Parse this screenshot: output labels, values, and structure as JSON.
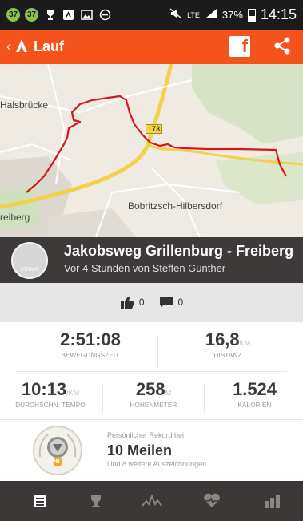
{
  "status_bar": {
    "notif_1": "37",
    "notif_2": "37",
    "network": "LTE",
    "battery": "37%",
    "time": "14:15"
  },
  "app_bar": {
    "title": "Lauf",
    "facebook_label": "f"
  },
  "map": {
    "labels": [
      "Halsbrücke",
      "Bobritzsch-Hilbersdorf",
      "reiberg"
    ],
    "road_number": "173",
    "route_color": "#d0181d"
  },
  "activity": {
    "title": "Jakobsweg Grillenburg - Freiberg",
    "subtitle": "Vor 4 Stunden von Steffen Günther",
    "avatar_text": "STRAVA"
  },
  "social": {
    "kudos_count": "0",
    "comments_count": "0"
  },
  "stats": {
    "moving_time": {
      "value": "2:51:08",
      "label": "BEWEGUNGSZEIT"
    },
    "distance": {
      "value": "16,8",
      "unit": "KM",
      "label": "DISTANZ"
    },
    "pace": {
      "value": "10:13",
      "unit": "/KM",
      "label": "DURCHSCHN. TEMPO"
    },
    "elevation": {
      "value": "258",
      "unit": "M",
      "label": "HÖHENMETER"
    },
    "calories": {
      "value": "1.524",
      "label": "KALORIEN"
    }
  },
  "achievement": {
    "small_label": "Persönlicher Rekord bei",
    "title": "10 Meilen",
    "more": "Und 8 weitere Auszeichnungen",
    "badge_text": "PR"
  },
  "colors": {
    "brand": "#f4531b",
    "dark": "#3b3837",
    "status_bar": "#1b1b1b"
  },
  "bottom_nav": [
    "overview-icon",
    "trophy-icon",
    "pace-icon",
    "heart-icon",
    "chart-icon"
  ]
}
